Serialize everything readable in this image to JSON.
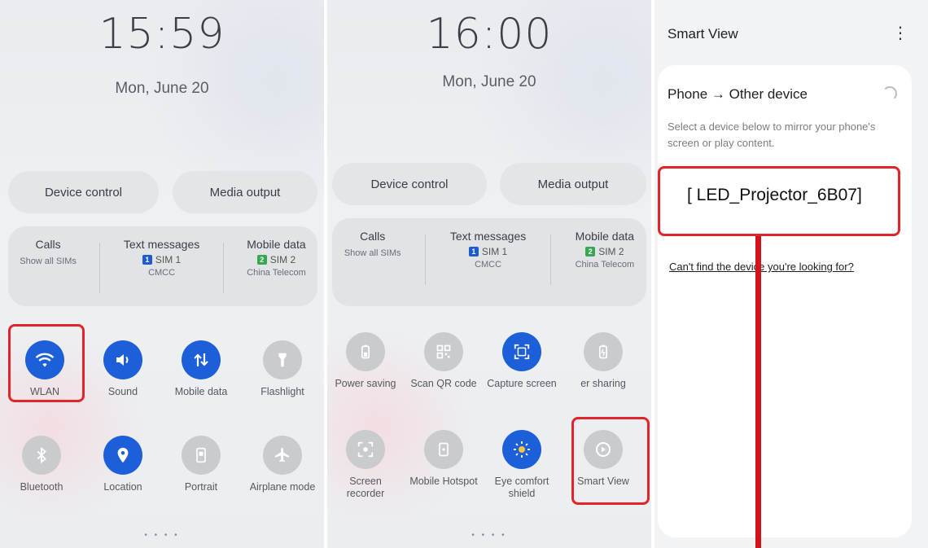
{
  "left": {
    "clock": "15:59",
    "date": "Mon, June 20",
    "device_control": "Device control",
    "media_output": "Media output",
    "sim": {
      "calls_title": "Calls",
      "calls_sub": "Show all SIMs",
      "text_title": "Text messages",
      "text_sim": "SIM 1",
      "text_sim_num": "1",
      "text_sub": "CMCC",
      "data_title": "Mobile data",
      "data_sim": "SIM 2",
      "data_sim_num": "2",
      "data_sub": "China Telecom"
    },
    "tiles": [
      {
        "label": "WLAN",
        "icon": "wifi-icon",
        "state": "on"
      },
      {
        "label": "Sound",
        "icon": "speaker-icon",
        "state": "on"
      },
      {
        "label": "Mobile data",
        "icon": "updown-arrows-icon",
        "state": "on"
      },
      {
        "label": "Flashlight",
        "icon": "flashlight-icon",
        "state": "off"
      },
      {
        "label": "Bluetooth",
        "icon": "bluetooth-icon",
        "state": "off"
      },
      {
        "label": "Location",
        "icon": "location-pin-icon",
        "state": "on"
      },
      {
        "label": "Portrait",
        "icon": "portrait-icon",
        "state": "off"
      },
      {
        "label": "Airplane mode",
        "icon": "airplane-icon",
        "state": "off"
      }
    ],
    "page_dots": "• • • •"
  },
  "middle": {
    "clock": "16:00",
    "date": "Mon, June 20",
    "device_control": "Device control",
    "media_output": "Media output",
    "sim": {
      "calls_title": "Calls",
      "calls_sub": "Show all SIMs",
      "text_title": "Text messages",
      "text_sim": "SIM 1",
      "text_sim_num": "1",
      "text_sub": "CMCC",
      "data_title": "Mobile data",
      "data_sim": "SIM 2",
      "data_sim_num": "2",
      "data_sub": "China Telecom"
    },
    "tiles": [
      {
        "label": "Power saving",
        "icon": "battery-icon",
        "state": "off"
      },
      {
        "label": "Scan QR code",
        "icon": "qr-code-icon",
        "state": "off"
      },
      {
        "label": "Capture screen",
        "icon": "screenshot-icon",
        "state": "on"
      },
      {
        "label": "er sharing",
        "icon": "battery-share-icon",
        "state": "off"
      },
      {
        "label": "Screen recorder",
        "icon": "screen-record-icon",
        "state": "off"
      },
      {
        "label": "Mobile Hotspot",
        "icon": "hotspot-icon",
        "state": "off"
      },
      {
        "label": "Eye comfort shield",
        "icon": "eye-comfort-icon",
        "state": "on"
      },
      {
        "label": "Smart View",
        "icon": "smart-view-icon",
        "state": "off"
      }
    ],
    "page_dots": "• • • •"
  },
  "smart_view": {
    "title": "Smart View",
    "more": "⋮",
    "heading": "Phone → Other device",
    "description": "Select a device below to mirror your phone's screen or play content.",
    "device": "[ LED_Projector_6B07]",
    "help_link": "Can't find the device you're looking for?"
  },
  "colors": {
    "accent": "#1c5fd8",
    "highlight": "#e0262b"
  }
}
